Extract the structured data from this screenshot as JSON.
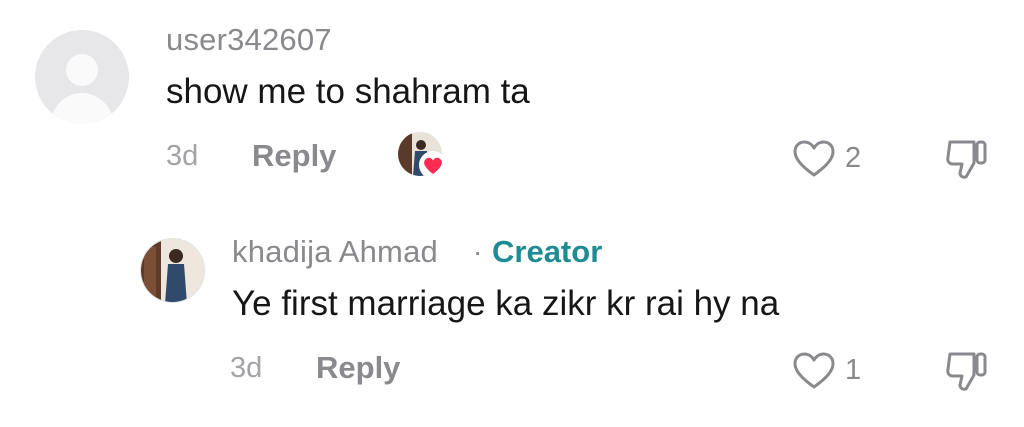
{
  "comments": [
    {
      "username": "user342607",
      "text": "show me to shahram ta",
      "age": "3d",
      "reply_label": "Reply",
      "like_count": "2"
    },
    {
      "username": "khadija Ahmad",
      "separator": "·",
      "badge": "Creator",
      "text": "Ye first marriage ka zikr kr rai hy na",
      "age": "3d",
      "reply_label": "Reply",
      "like_count": "1"
    }
  ],
  "colors": {
    "muted": "#8a8a8e",
    "creator_badge": "#1f8c94",
    "heart_badge": "#fe2c55"
  },
  "icons": [
    "default-avatar-icon",
    "heart-outline-icon",
    "thumbs-down-icon",
    "heart-filled-icon"
  ]
}
